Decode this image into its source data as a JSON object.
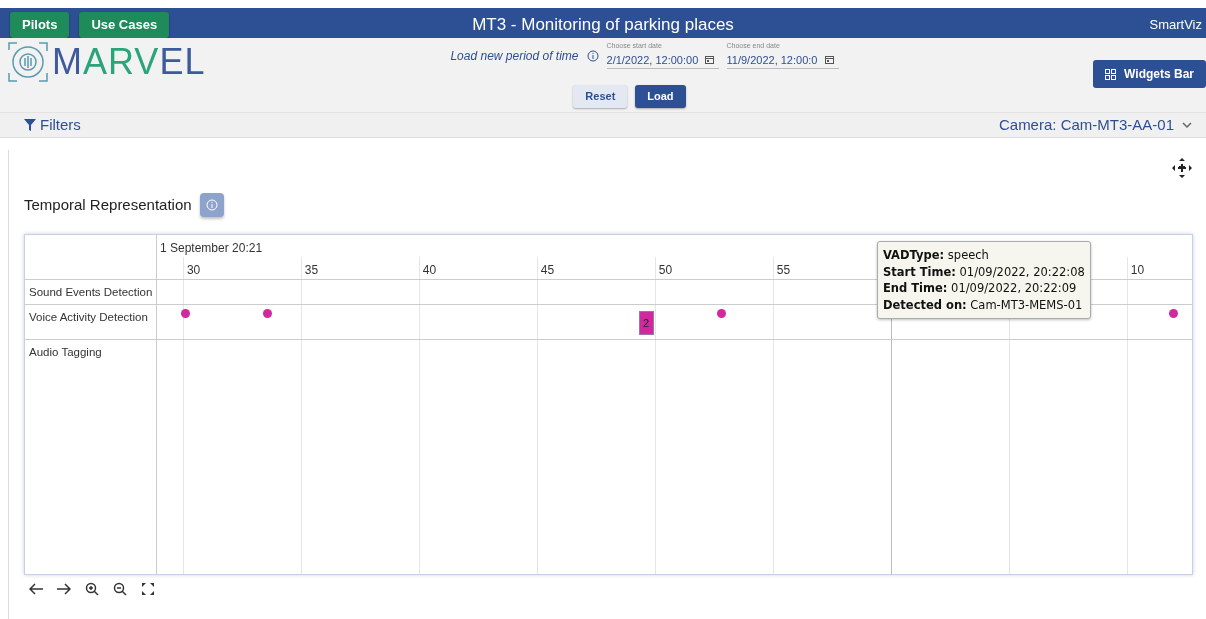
{
  "top_bar": {
    "buttons": [
      "Pilots",
      "Use Cases"
    ],
    "title": "MT3 - Monitoring of parking places",
    "brand": "SmartViz"
  },
  "logo": {
    "text": "MARVEL"
  },
  "period": {
    "label": "Load new period of time",
    "start": {
      "label": "Choose start date",
      "value": "2/1/2022, 12:00:00"
    },
    "end": {
      "label": "Choose end date",
      "value": "11/9/2022, 12:00:0"
    },
    "buttons": [
      "Reset",
      "Load"
    ]
  },
  "widgets_button": "Widgets Bar",
  "filters": {
    "label": "Filters",
    "camera": "Camera: Cam-MT3-AA-01"
  },
  "widget": {
    "title": "Temporal Representation",
    "timeline": {
      "date_label": "1 September 20:21",
      "ticks": [
        {
          "label": "30",
          "level": 0.025,
          "kind": "minor"
        },
        {
          "label": "35",
          "level": 0.139,
          "kind": "minor"
        },
        {
          "label": "40",
          "level": 0.253,
          "kind": "minor"
        },
        {
          "label": "45",
          "level": 0.367,
          "kind": "minor"
        },
        {
          "label": "50",
          "level": 0.481,
          "kind": "minor"
        },
        {
          "label": "55",
          "level": 0.595,
          "kind": "minor"
        },
        {
          "level": 0.709,
          "kind": "major"
        },
        {
          "level": 0.823,
          "kind": "minor"
        },
        {
          "label": "10",
          "level": 0.937,
          "kind": "minor"
        }
      ],
      "groups": [
        {
          "label": "Sound Events Detection"
        },
        {
          "label": "Voice Activity Detection",
          "items": [
            {
              "kind": "dot",
              "level": 0.027
            },
            {
              "kind": "dot",
              "level": 0.106
            },
            {
              "kind": "cluster",
              "level": 0.472,
              "count": "2"
            },
            {
              "kind": "dot",
              "level": 0.545
            },
            {
              "kind": "dot",
              "level": 0.982
            }
          ]
        },
        {
          "label": "Audio Tagging"
        }
      ],
      "tooltip": [
        "**VADType:** speech",
        "**Start Time:** 01/09/2022, 20:22:08",
        "**End Time:** 01/09/2022, 20:22:09",
        "**Detected on:** Cam-MT3-MEMS-01"
      ]
    }
  }
}
